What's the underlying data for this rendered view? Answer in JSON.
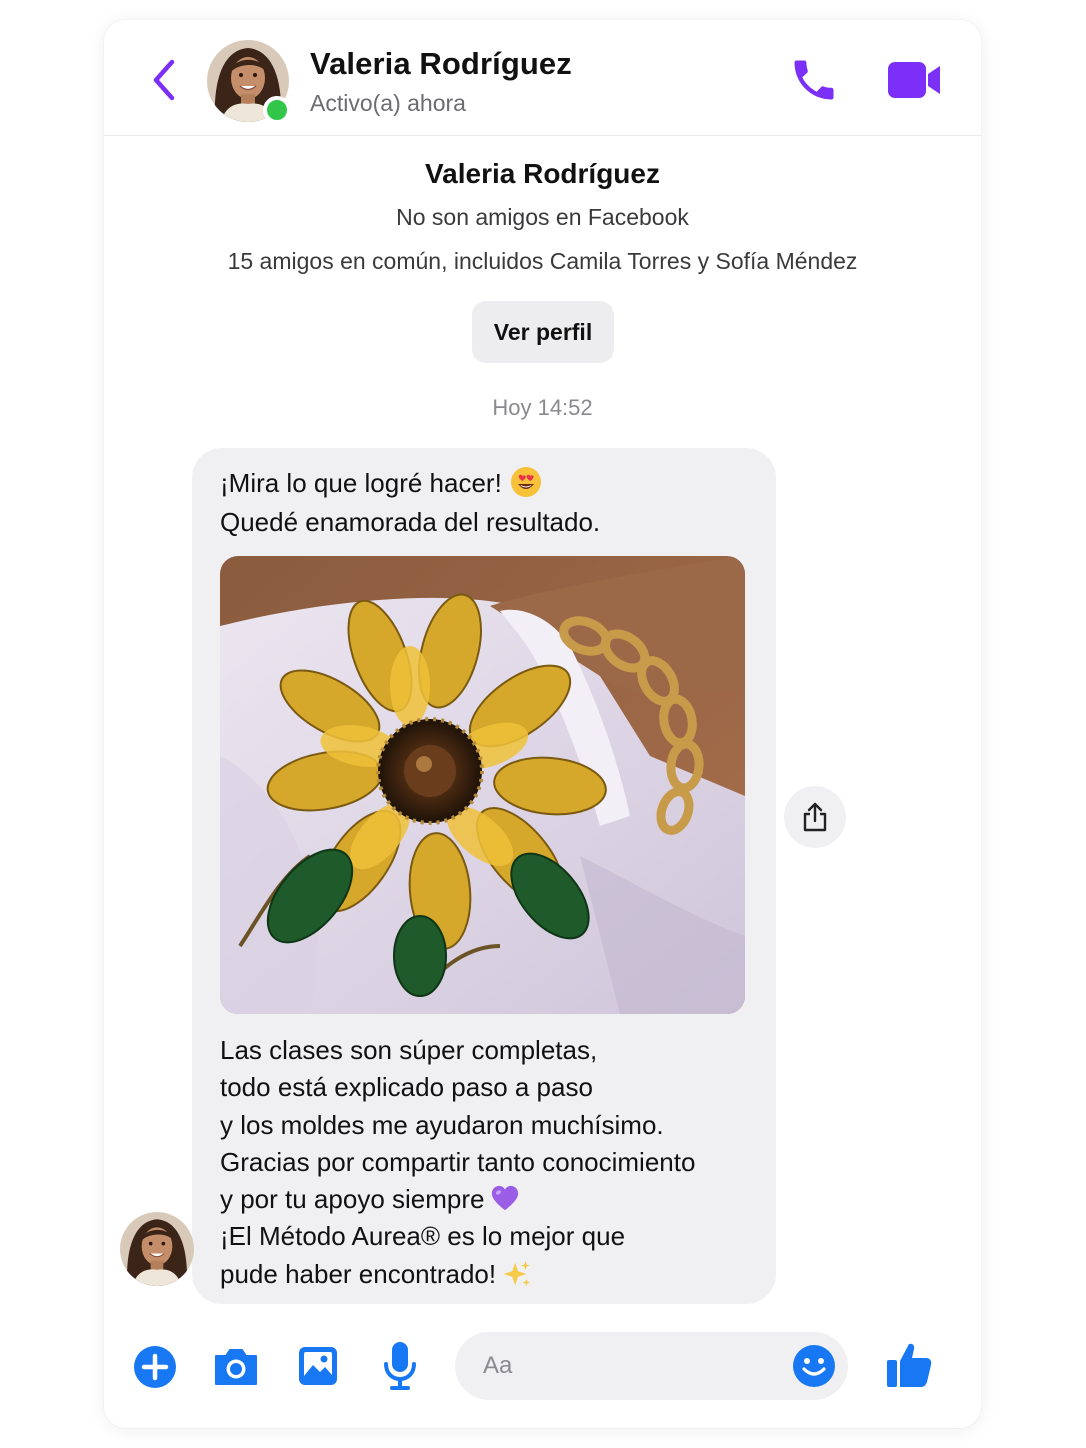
{
  "colors": {
    "accent_purple": "#7b2ff7",
    "accent_blue": "#1877f2",
    "online_green": "#31c64a",
    "bubble_bg": "#f0f0f2"
  },
  "header": {
    "name": "Valeria Rodríguez",
    "status": "Activo(a) ahora",
    "icons": [
      "chevron-left-icon",
      "phone-icon",
      "video-camera-icon"
    ]
  },
  "intro": {
    "name": "Valeria Rodríguez",
    "relation": "No son amigos en Facebook",
    "mutual": "15 amigos en común, incluidos Camila Torres y Sofía Méndez",
    "profile_button": "Ver perfil"
  },
  "timestamp": "Hoy 14:52",
  "message": {
    "top_lines": [
      "¡Mira lo que logré hacer!",
      "Quedé enamorada del resultado."
    ],
    "top_emoji": "heart-eyes-emoji",
    "bottom_lines": [
      "Las clases son súper completas,",
      "todo está explicado paso a paso",
      "y los moldes me ayudaron muchísimo.",
      "Gracias por compartir tanto conocimiento",
      "y por tu apoyo siempre",
      "¡El Método Aurea® es lo mejor que",
      "pude haber encontrado!"
    ],
    "line5_emoji": "purple-heart-emoji",
    "line7_emoji": "sparkles-emoji",
    "photo": "beaded-sunflower-brooch-photo"
  },
  "composer": {
    "placeholder": "Aa",
    "icons": [
      "plus-circle-icon",
      "camera-icon",
      "image-icon",
      "microphone-icon",
      "smiley-icon",
      "thumbs-up-icon"
    ]
  }
}
